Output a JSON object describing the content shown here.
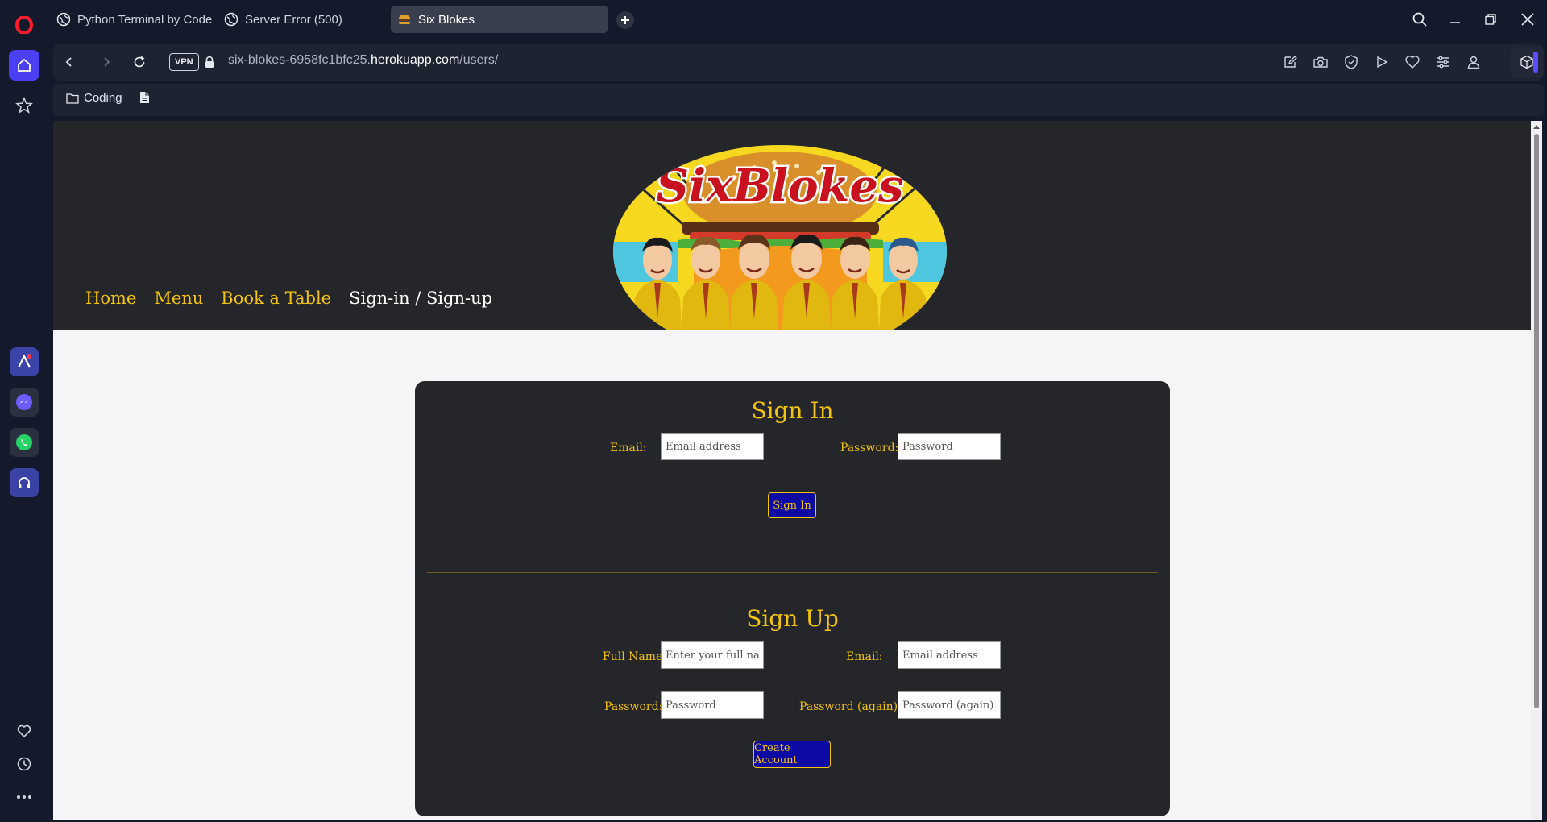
{
  "browser": {
    "tabs": [
      {
        "label": "Python Terminal by Code"
      },
      {
        "label": "Server Error (500)"
      },
      {
        "label": "Six Blokes",
        "active": true
      }
    ],
    "vpn_label": "VPN",
    "url": {
      "prefix": "six-blokes-6958fc1bfc25.",
      "domain": "herokuapp.com",
      "path": "/users/"
    },
    "bookmarks": [
      {
        "label": "Coding"
      }
    ]
  },
  "site": {
    "logo_text": "SixBlokes",
    "nav": [
      "Home",
      "Menu",
      "Book a Table",
      "Sign-in / Sign-up"
    ],
    "accent_color": "#f3c40f"
  },
  "signin": {
    "title": "Sign In",
    "email_label": "Email:",
    "email_placeholder": "Email address",
    "password_label": "Password:",
    "password_placeholder": "Password",
    "button": "Sign In"
  },
  "signup": {
    "title": "Sign Up",
    "fullname_label": "Full Name:",
    "fullname_placeholder": "Enter your full name",
    "email_label": "Email:",
    "email_placeholder": "Email address",
    "password_label": "Password:",
    "password_placeholder": "Password",
    "password2_label": "Password (again):",
    "password2_placeholder": "Password (again)",
    "button": "Create Account"
  }
}
